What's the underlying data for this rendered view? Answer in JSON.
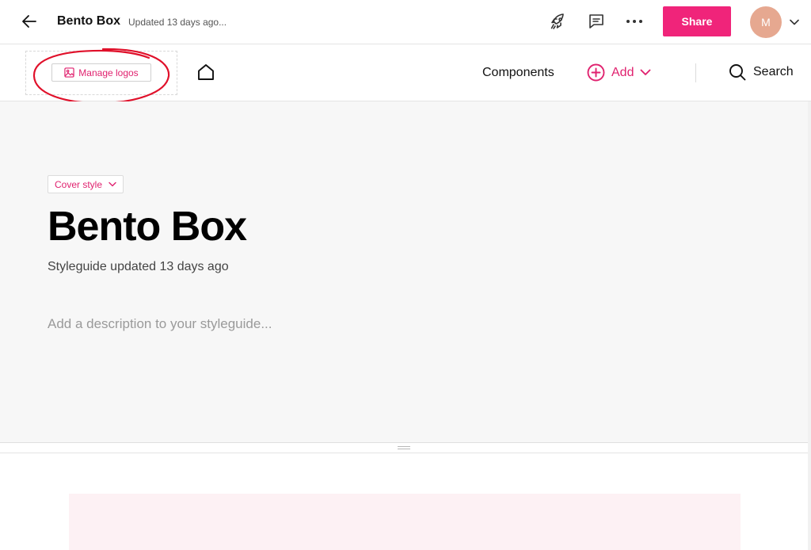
{
  "topbar": {
    "title": "Bento Box",
    "updated": "Updated 13 days ago...",
    "share_label": "Share",
    "avatar_initial": "M",
    "icons": [
      "back-arrow-icon",
      "rocket-icon",
      "comment-icon",
      "more-icon",
      "chevron-down-icon"
    ]
  },
  "navbar": {
    "manage_logos_label": "Manage logos",
    "components_label": "Components",
    "add_label": "Add",
    "search_label": "Search",
    "icons": [
      "image-icon",
      "home-icon",
      "plus-circle-icon",
      "chevron-down-icon",
      "search-icon"
    ]
  },
  "cover": {
    "style_label": "Cover style",
    "title": "Bento Box",
    "subtitle": "Styleguide updated 13 days ago",
    "description_placeholder": "Add a description to your styleguide..."
  },
  "colors": {
    "accent": "#f0247a",
    "accent_text": "#e0226f",
    "avatar_bg": "#e6a890",
    "cover_bg": "#f7f7f7",
    "annotation": "#e0102a"
  }
}
